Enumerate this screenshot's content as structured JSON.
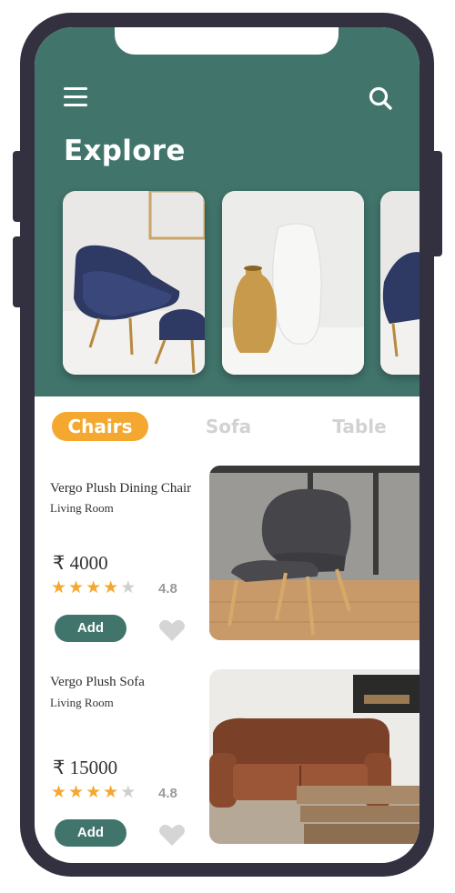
{
  "header": {
    "title": "Explore",
    "menu_icon": "hamburger-menu-icon",
    "search_icon": "search-icon",
    "background_color": "#41756c"
  },
  "carousel": [
    {
      "subject": "blue-lounge-chair-with-ottoman"
    },
    {
      "subject": "ceramic-vases"
    },
    {
      "subject": "blue-lounge-chair-partial"
    }
  ],
  "tabs": [
    {
      "label": "Chairs",
      "active": true
    },
    {
      "label": "Sofa",
      "active": false
    },
    {
      "label": "Table",
      "active": false
    }
  ],
  "products": [
    {
      "name": "Vergo Plush Dining Chair",
      "category": "Living Room",
      "price": "4000",
      "currency_symbol": "₹",
      "rating": "4.8",
      "stars_filled": 4,
      "stars_total": 5,
      "add_label": "Add",
      "favorite_icon": "heart-icon"
    },
    {
      "name": "Vergo Plush Sofa",
      "category": "Living Room",
      "price": "15000",
      "currency_symbol": "₹",
      "rating": "4.8",
      "stars_filled": 4,
      "stars_total": 5,
      "add_label": "Add",
      "favorite_icon": "heart-icon"
    }
  ],
  "colors": {
    "accent": "#f5a830",
    "primary": "#41756c",
    "frame": "#33313f"
  }
}
